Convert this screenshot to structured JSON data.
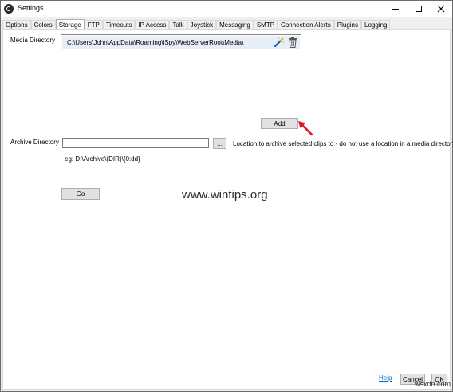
{
  "window": {
    "title": "Settings"
  },
  "tabs": [
    {
      "label": "Options"
    },
    {
      "label": "Colors"
    },
    {
      "label": "Storage"
    },
    {
      "label": "FTP"
    },
    {
      "label": "Timeouts"
    },
    {
      "label": "IP Access"
    },
    {
      "label": "Talk"
    },
    {
      "label": "Joystick"
    },
    {
      "label": "Messaging"
    },
    {
      "label": "SMTP"
    },
    {
      "label": "Connection Alerts"
    },
    {
      "label": "Plugins"
    },
    {
      "label": "Logging"
    }
  ],
  "active_tab": "Storage",
  "media": {
    "label": "Media Directory",
    "items": [
      "C:\\Users\\John\\AppData\\Roaming\\iSpy\\WebServerRoot\\Media\\"
    ],
    "add_label": "Add"
  },
  "archive": {
    "label": "Archive Directory",
    "value": "",
    "browse_label": "...",
    "hint": "Location to archive selected clips to - do not use a location in a media directory.",
    "example": "eg: D:\\Archive\\{DIR}\\{0:dd}"
  },
  "go_label": "Go",
  "footer": {
    "help": "Help",
    "cancel": "Cancel",
    "ok": "OK"
  },
  "watermark": "www.wintips.org",
  "brand": "wsxdn.com",
  "colors": {
    "selected_row": "#e8eef8",
    "link": "#0066cc",
    "arrow": "#e0141e"
  }
}
